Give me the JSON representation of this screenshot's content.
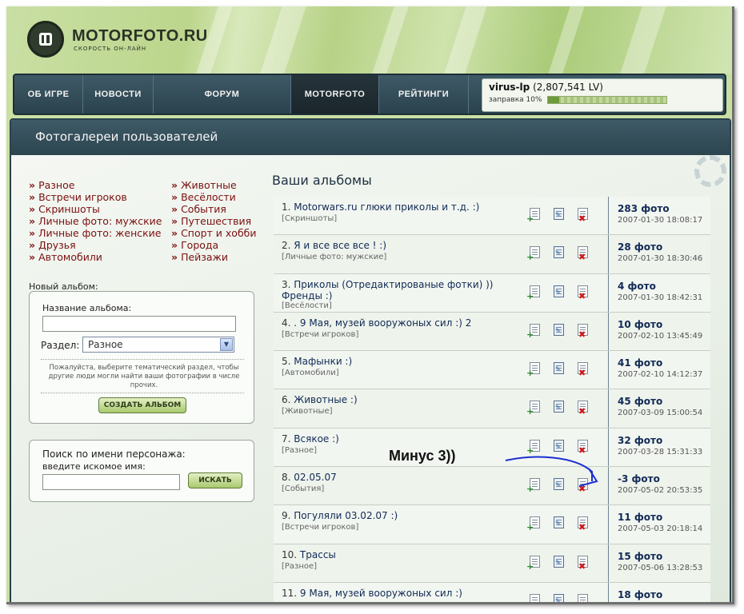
{
  "site": {
    "logo_title": "MOTORFOTO.RU",
    "logo_subtitle": "СКОРОСТЬ ОН-ЛАЙН"
  },
  "nav": {
    "items": [
      "ОБ ИГРЕ",
      "НОВОСТИ",
      "ФОРУМ",
      "MOTORFOTO",
      "РЕЙТИНГИ"
    ],
    "active": "MOTORFOTO"
  },
  "user": {
    "name": "virus-lp",
    "lv": "(2,807,541 LV)",
    "refuel_label": "заправка 10%",
    "refuel_percent": 10
  },
  "panel": {
    "title": "Фотогалереи пользователей"
  },
  "categories": {
    "left": [
      "Разное",
      "Встречи игроков",
      "Скриншоты",
      "Личные фото: мужские",
      "Личные фото: женские",
      "Друзья",
      "Автомобили"
    ],
    "right": [
      "Животные",
      "Весёлости",
      "События",
      "Путешествия",
      "Спорт и хобби",
      "Города",
      "Пейзажи"
    ],
    "bullet": "»"
  },
  "new_album": {
    "heading": "Новый альбом:",
    "name_label": "Название альбома:",
    "name_value": "",
    "section_label": "Раздел:",
    "section_value": "Разное",
    "hint": "Пожалуйста, выберите тематический раздел, чтобы другие люди могли найти ваши фотографии в числе прочих.",
    "create_button": "СОЗДАТЬ АЛЬБОМ"
  },
  "search": {
    "title": "Поиск по имени персонажа:",
    "subtitle": "введите искомое имя:",
    "value": "",
    "button": "ИСКАТЬ"
  },
  "albums": {
    "heading": "Ваши альбомы",
    "items": [
      {
        "num": "1.",
        "title": "Motorwars.ru глюки приколы и т.д. :)",
        "category": "[Скриншоты]",
        "count": "283 фото",
        "date": "2007-01-30 18:08:17"
      },
      {
        "num": "2.",
        "title": "Я и все все все ! :)",
        "category": "[Личные фото: мужские]",
        "count": "28 фото",
        "date": "2007-01-30 18:30:46"
      },
      {
        "num": "3.",
        "title": "Приколы (Отредактированые фотки) )) Френды :)",
        "category": "[Весёлости]",
        "count": "4 фото",
        "date": "2007-01-30 18:42:31"
      },
      {
        "num": "4.",
        "title": ". 9 Мая, музей вооружоных сил :) 2",
        "category": "[Встречи игроков]",
        "count": "10 фото",
        "date": "2007-02-10 13:45:49"
      },
      {
        "num": "5.",
        "title": "Мафынки :)",
        "category": "[Автомобили]",
        "count": "41 фото",
        "date": "2007-02-10 14:12:37"
      },
      {
        "num": "6.",
        "title": "Животные :)",
        "category": "[Животные]",
        "count": "45 фото",
        "date": "2007-03-09 15:00:54"
      },
      {
        "num": "7.",
        "title": "Всякое :)",
        "category": "[Разное]",
        "count": "32 фото",
        "date": "2007-03-28 15:31:33"
      },
      {
        "num": "8.",
        "title": "02.05.07",
        "category": "[События]",
        "count": "-3 фото",
        "date": "2007-05-02 20:53:35"
      },
      {
        "num": "9.",
        "title": "Погуляли 03.02.07 :)",
        "category": "[Встречи игроков]",
        "count": "11 фото",
        "date": "2007-05-03 20:18:14"
      },
      {
        "num": "10.",
        "title": "Трассы",
        "category": "[Разное]",
        "count": "15 фото",
        "date": "2007-05-06 13:28:53"
      },
      {
        "num": "11.",
        "title": "9 Мая, музей вооружоных сил :)",
        "category": "",
        "count": "18 фото",
        "date": ""
      }
    ]
  },
  "annotation": {
    "text": "Минус 3))",
    "color": "#1a2fd0"
  },
  "colors": {
    "nav_bg": "#2a424d",
    "category_link": "#7a1010",
    "album_title": "#112a55"
  }
}
